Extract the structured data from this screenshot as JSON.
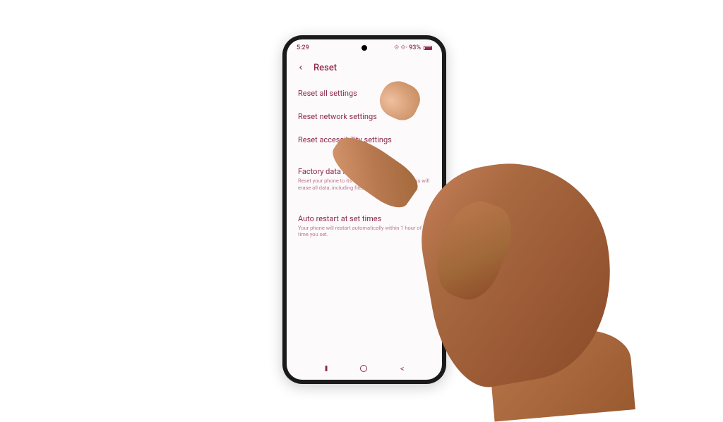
{
  "status_bar": {
    "time": "5:29",
    "indicators": "⟐ ⟐·",
    "battery_percent": "93%"
  },
  "header": {
    "title": "Reset"
  },
  "menu_items": [
    {
      "title": "Reset all settings",
      "desc": ""
    },
    {
      "title": "Reset network settings",
      "desc": ""
    },
    {
      "title": "Reset accessibility settings",
      "desc": ""
    },
    {
      "title": "Factory data reset",
      "desc": "Reset your phone to its factory default settings. This will erase all data, including files and downloaded apps."
    },
    {
      "title": "Auto restart at set times",
      "desc": "Your phone will restart automatically within 1 hour of the time you set."
    }
  ]
}
